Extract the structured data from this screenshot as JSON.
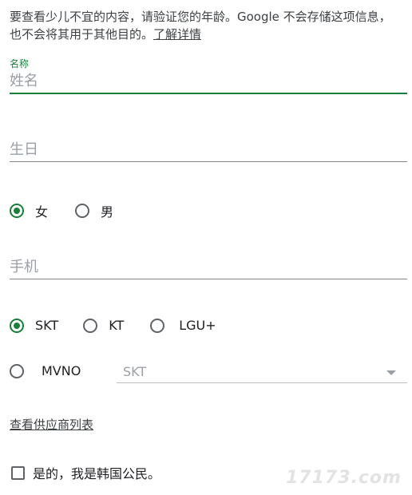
{
  "intro": {
    "text": "要查看少儿不宜的内容，请验证您的年龄。Google 不会存储这项信息，也不会将其用于其他目的。",
    "link_label": "了解详情"
  },
  "name_field": {
    "label": "名称",
    "placeholder": "姓名",
    "value": ""
  },
  "birthday_field": {
    "placeholder": "生日",
    "value": ""
  },
  "gender": {
    "options": [
      "女",
      "男"
    ],
    "selected": "女"
  },
  "phone_field": {
    "placeholder": "手机",
    "value": ""
  },
  "carrier": {
    "options": [
      "SKT",
      "KT",
      "LGU+",
      "MVNO"
    ],
    "selected": "SKT",
    "mvno_select": {
      "value": "SKT"
    }
  },
  "carrier_list_link": "查看供应商列表",
  "citizen_checkbox": {
    "label": "是的，我是韩国公民。",
    "checked": false
  },
  "watermark": "17173.com",
  "colors": {
    "accent": "#188038",
    "text": "#202124",
    "placeholder": "#9aa0a6",
    "underline": "#80868b"
  }
}
